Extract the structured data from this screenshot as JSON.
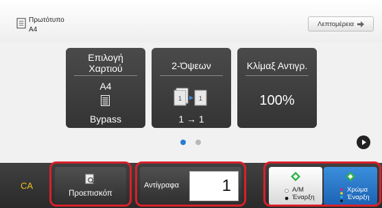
{
  "original": {
    "title": "Πρωτότυπο",
    "size": "A4",
    "details_label": "Λεπτομέρεια"
  },
  "tiles": {
    "paper": {
      "title": "Επιλογή\nΧαρτιού",
      "size": "A4",
      "tray": "Bypass"
    },
    "duplex": {
      "title": "2-Όψεων",
      "value": "1 → 1"
    },
    "ratio": {
      "title": "Κλίμαξ Αντιγρ.",
      "value": "100%"
    }
  },
  "pager": {
    "pages": 2,
    "current": 1
  },
  "bottom": {
    "ca_label": "CA",
    "preview_label": "Προεπισκόπ",
    "copies_label": "Αντίγραφα",
    "copies_value": "1",
    "bw_start": {
      "line1": "Α/Μ",
      "line2": "Έναρξη"
    },
    "color_start": {
      "line1": "Χρώμα",
      "line2": "Έναρξη"
    }
  },
  "colors": {
    "highlight": "#d9202b",
    "accent_blue": "#2b7bd4",
    "ca_yellow": "#f0c020",
    "start_green": "#2fb34a"
  },
  "icons": [
    "document-icon",
    "arrow-right-icon",
    "paper-tray-icon",
    "duplex-icon",
    "play-icon",
    "preview-icon",
    "start-diamond-icon"
  ]
}
